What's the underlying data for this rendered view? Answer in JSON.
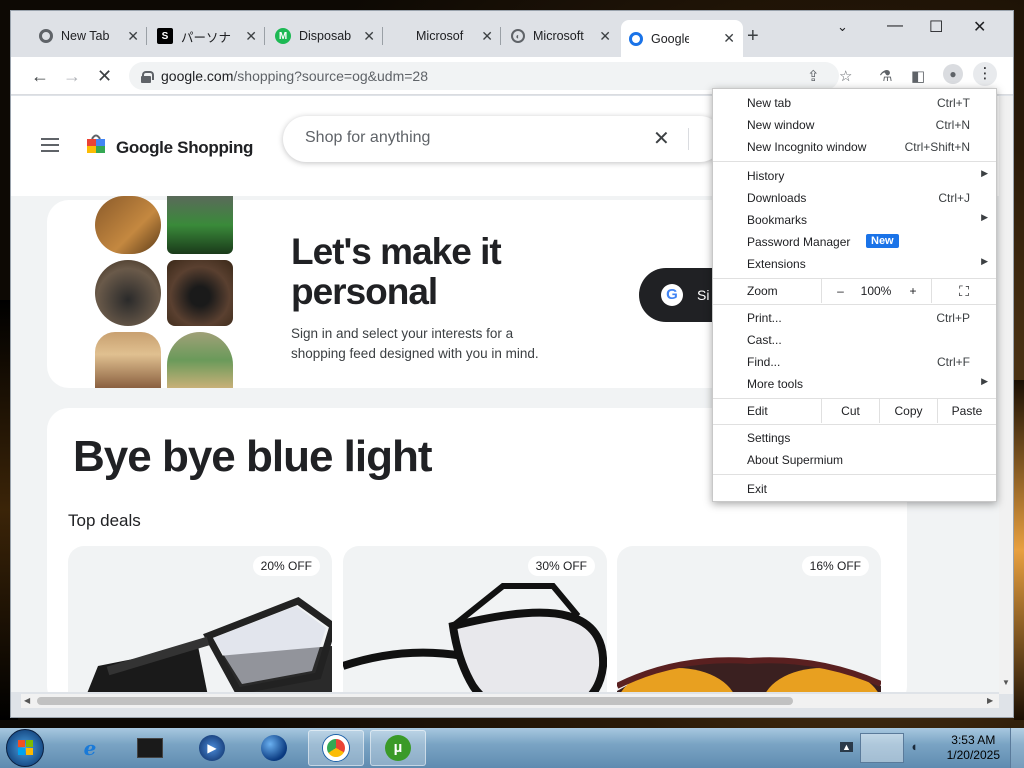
{
  "browser": {
    "tabs": [
      {
        "title": "New Tab",
        "favicon": "chrome-icon"
      },
      {
        "title": "パーソナ",
        "favicon": "s-icon"
      },
      {
        "title": "Disposab",
        "favicon": "m-icon"
      },
      {
        "title": "Microsof",
        "favicon": "microsoft-icon"
      },
      {
        "title": "Microsoft",
        "favicon": "globe-icon"
      },
      {
        "title": "Google S",
        "favicon": "google-shopping-icon"
      }
    ],
    "url_host": "google.com",
    "url_path": "/shopping?source=og&udm=28"
  },
  "page": {
    "brand": "Google Shopping",
    "search_placeholder": "Shop for anything",
    "hero_title_line1": "Let's make it",
    "hero_title_line2": "personal",
    "hero_sub_line1": "Sign in and select your interests for a",
    "hero_sub_line2": "shopping feed designed with you in mind.",
    "signin_label": "Si",
    "deals_title": "Bye bye blue light",
    "top_deals_label": "Top deals",
    "deals": [
      {
        "badge": "20% OFF"
      },
      {
        "badge": "30% OFF"
      },
      {
        "badge": "16% OFF"
      }
    ]
  },
  "menu": {
    "new_tab": "New tab",
    "new_tab_sc": "Ctrl+T",
    "new_window": "New window",
    "new_window_sc": "Ctrl+N",
    "incognito": "New Incognito window",
    "incognito_sc": "Ctrl+Shift+N",
    "history": "History",
    "downloads": "Downloads",
    "downloads_sc": "Ctrl+J",
    "bookmarks": "Bookmarks",
    "password_manager": "Password Manager",
    "new_badge": "New",
    "extensions": "Extensions",
    "zoom": "Zoom",
    "zoom_minus": "–",
    "zoom_value": "100%",
    "zoom_plus": "+",
    "print": "Print...",
    "print_sc": "Ctrl+P",
    "cast": "Cast...",
    "find": "Find...",
    "find_sc": "Ctrl+F",
    "more_tools": "More tools",
    "edit": "Edit",
    "cut": "Cut",
    "copy": "Copy",
    "paste": "Paste",
    "settings": "Settings",
    "about": "About Supermium",
    "exit": "Exit"
  },
  "taskbar": {
    "time": "3:53 AM",
    "date": "1/20/2025"
  }
}
